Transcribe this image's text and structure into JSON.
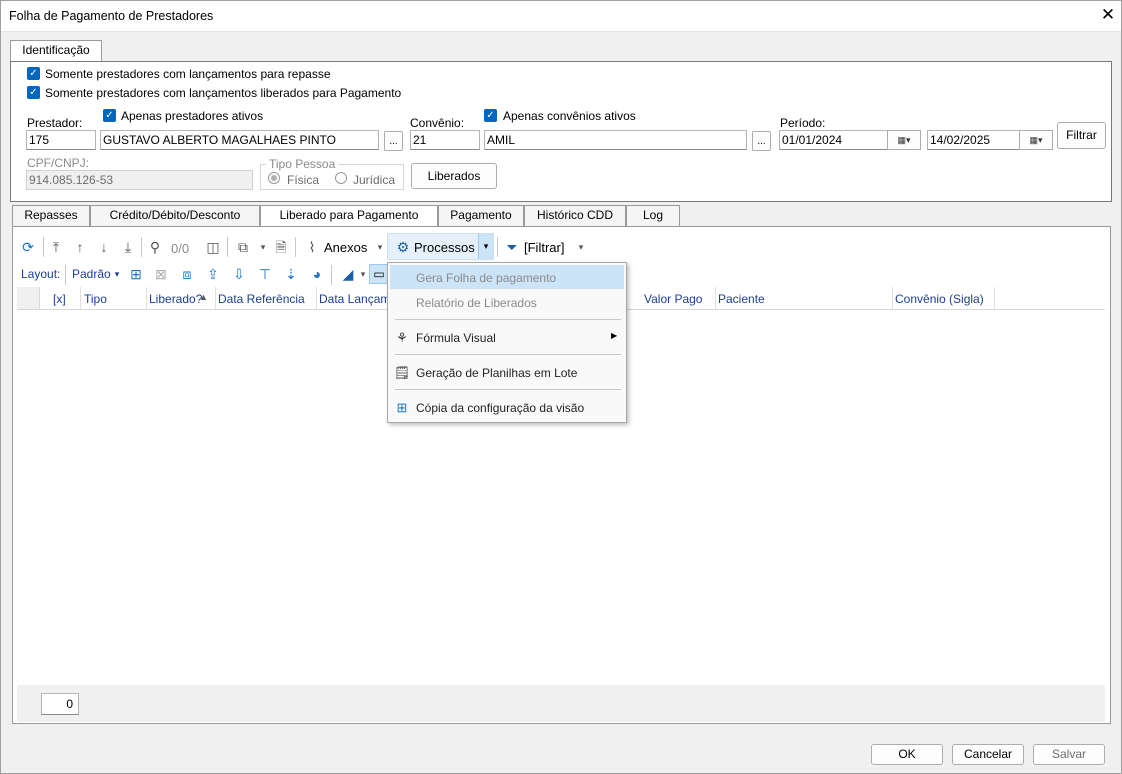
{
  "window": {
    "title": "Folha de Pagamento de Prestadores",
    "close_label": "✕"
  },
  "top_tab": "Identificação",
  "filters": {
    "check_repasse": "Somente prestadores com lançamentos para repasse",
    "check_liberados": "Somente prestadores com lançamentos liberados para Pagamento",
    "prestador_label": "Prestador:",
    "prestador_code": "175",
    "prestador_name": "GUSTAVO ALBERTO MAGALHAES PINTO",
    "check_prestadores_ativos": "Apenas prestadores ativos",
    "convenio_label": "Convênio:",
    "convenio_code": "21",
    "convenio_name": "AMIL",
    "check_convenios_ativos": "Apenas convênios ativos",
    "periodo_label": "Período:",
    "date_start": "01/01/2024",
    "date_end": "14/02/2025",
    "filtrar_button": "Filtrar",
    "cpf_label": "CPF/CNPJ:",
    "cpf_value": "914.085.126-53",
    "tipo_pessoa_label": "Tipo Pessoa",
    "radio_fisica": "Física",
    "radio_juridica": "Jurídica",
    "liberados_button": "Liberados",
    "ellipsis": "..."
  },
  "tabs": [
    "Repasses",
    "Crédito/Débito/Desconto",
    "Liberado para Pagamento",
    "Pagamento",
    "Histórico CDD",
    "Log"
  ],
  "toolbar": {
    "counter": "0/0",
    "anexos": "Anexos",
    "processos": "Processos",
    "filtrar": "[Filtrar]",
    "layout_label": "Layout:",
    "layout_value": "Padrão"
  },
  "grid": {
    "columns": [
      "[x]",
      "Tipo",
      "Liberado?",
      "Data Referência",
      "Data Lançame",
      "Valor Pago",
      "Paciente",
      "Convênio (Sigla)"
    ],
    "row_count": "0"
  },
  "menu": {
    "items": [
      "Gera Folha de pagamento",
      "Relatório de Liberados",
      "Fórmula Visual",
      "Geração de Planilhas em Lote",
      "Cópia da configuração da visão"
    ]
  },
  "footer": {
    "ok": "OK",
    "cancelar": "Cancelar",
    "salvar": "Salvar"
  },
  "colors": {
    "accent": "#0067c0",
    "header_text": "#1c3f95",
    "menu_highlight": "#cce4f7"
  }
}
